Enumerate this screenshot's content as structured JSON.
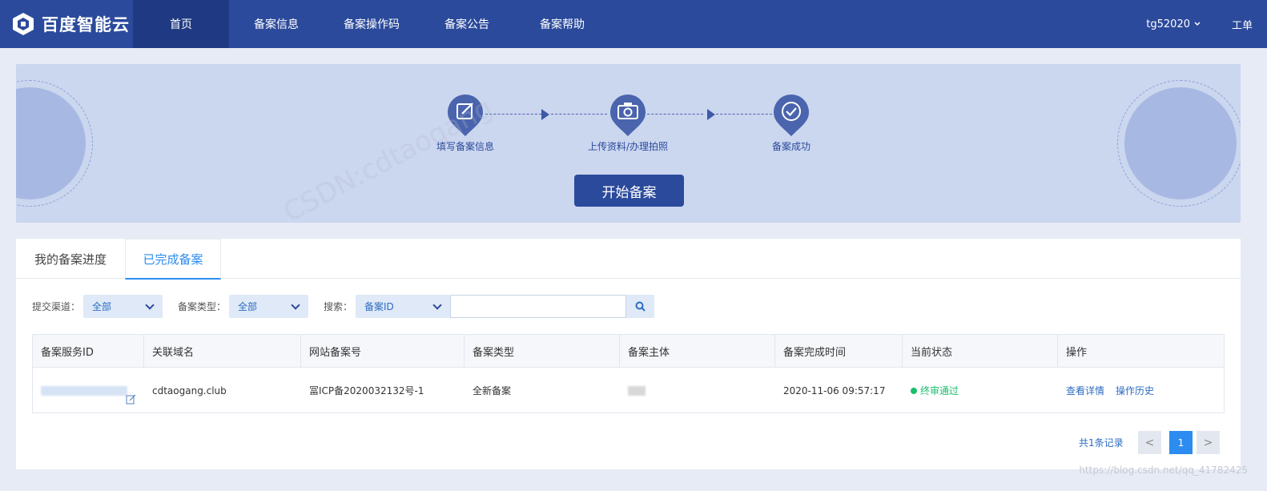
{
  "nav": {
    "brand": "百度智能云",
    "items": [
      "首页",
      "备案信息",
      "备案操作码",
      "备案公告",
      "备案帮助"
    ],
    "user": "tg52020",
    "ticket": "工单"
  },
  "banner": {
    "steps": [
      "填写备案信息",
      "上传资料/办理拍照",
      "备案成功"
    ],
    "start_button": "开始备案"
  },
  "tabs": [
    "我的备案进度",
    "已完成备案"
  ],
  "filters": {
    "channel_label": "提交渠道：",
    "channel_value": "全部",
    "type_label": "备案类型：",
    "type_value": "全部",
    "search_label": "搜索：",
    "search_field": "备案ID",
    "search_value": ""
  },
  "table": {
    "headers": [
      "备案服务ID",
      "关联域名",
      "网站备案号",
      "备案类型",
      "备案主体",
      "备案完成时间",
      "当前状态",
      "操作"
    ],
    "rows": [
      {
        "domain": "cdtaogang.club",
        "icp": "冨ICP备2020032132号-1",
        "type": "全新备案",
        "finish_time": "2020-11-06 09:57:17",
        "status": "终审通过",
        "op_detail": "查看详情",
        "op_history": "操作历史"
      }
    ]
  },
  "pager": {
    "total": "共1条记录",
    "current": "1",
    "prev": "<",
    "next": ">"
  },
  "watermark": "CSDN:cdtaogang",
  "footer_mark": "https://blog.csdn.net/qq_41782425",
  "colors": {
    "nav": "#2b4a9b",
    "accent": "#2d8cf0",
    "success": "#19be6b"
  }
}
